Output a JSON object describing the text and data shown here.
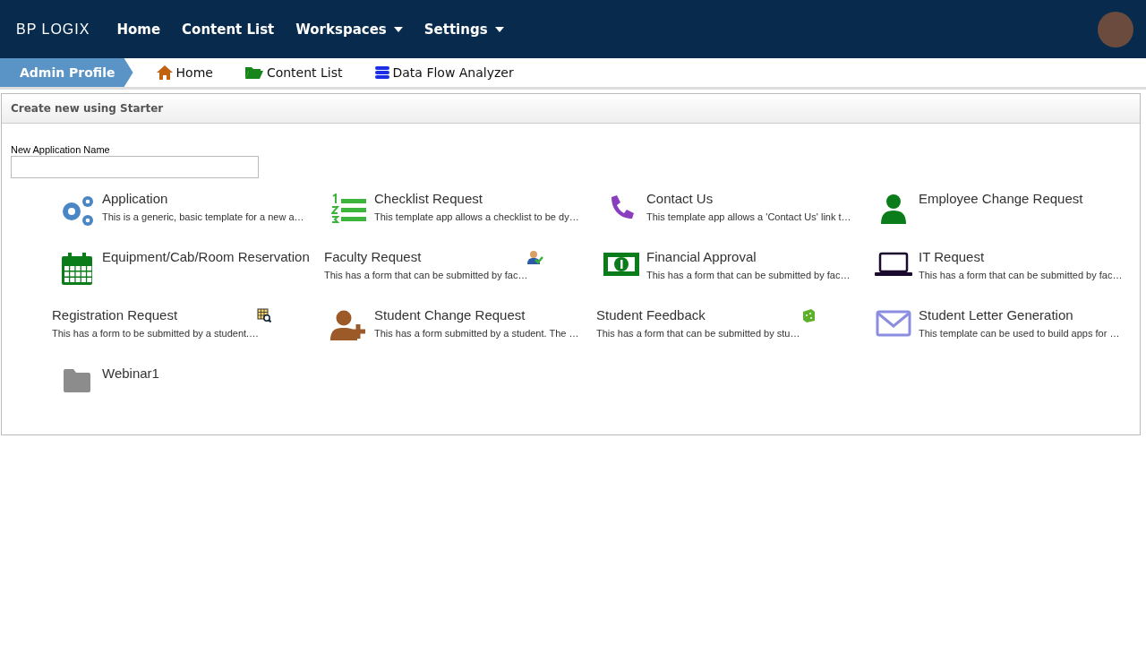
{
  "topbar": {
    "logo": "BP LOGIX",
    "menu": [
      {
        "label": "Home",
        "dropdown": false
      },
      {
        "label": "Content List",
        "dropdown": false
      },
      {
        "label": "Workspaces",
        "dropdown": true
      },
      {
        "label": "Settings",
        "dropdown": true
      }
    ]
  },
  "breadcrumb": {
    "current": "Admin Profile",
    "links": [
      "Home",
      "Content List",
      "Data Flow Analyzer"
    ]
  },
  "panel": {
    "title": "Create new using Starter",
    "field_label": "New Application Name",
    "starters": [
      {
        "kind": "large",
        "title": "Application",
        "description": "This is a generic, basic template for a new a…"
      },
      {
        "kind": "large",
        "title": "Checklist Request",
        "description": "This template app allows a checklist to be dy…"
      },
      {
        "kind": "large",
        "title": "Contact Us",
        "description": "This template app allows a 'Contact Us' link t…"
      },
      {
        "kind": "large",
        "title": "Employee Change Request"
      },
      {
        "kind": "large",
        "title": "Equipment/Cab/Room Reservation"
      },
      {
        "kind": "small",
        "title": "Faculty Request",
        "description": "This has a form that can be submitted by fac…"
      },
      {
        "kind": "large",
        "title": "Financial Approval",
        "description": "This has a form that can be submitted by fac…"
      },
      {
        "kind": "large",
        "title": "IT Request",
        "description": "This has a form that can be submitted by fac…"
      },
      {
        "kind": "small",
        "title": "Registration Request",
        "description": "This has a form to be submitted by a student.…"
      },
      {
        "kind": "large",
        "title": "Student Change Request",
        "description": "This has a form submitted by a student. The …"
      },
      {
        "kind": "small",
        "title": "Student Feedback",
        "description": "This has a form that can be submitted by stu…"
      },
      {
        "kind": "large",
        "title": "Student Letter Generation",
        "description": "This template can be used to build apps for …"
      },
      {
        "kind": "large",
        "title": "Webinar1"
      }
    ]
  }
}
